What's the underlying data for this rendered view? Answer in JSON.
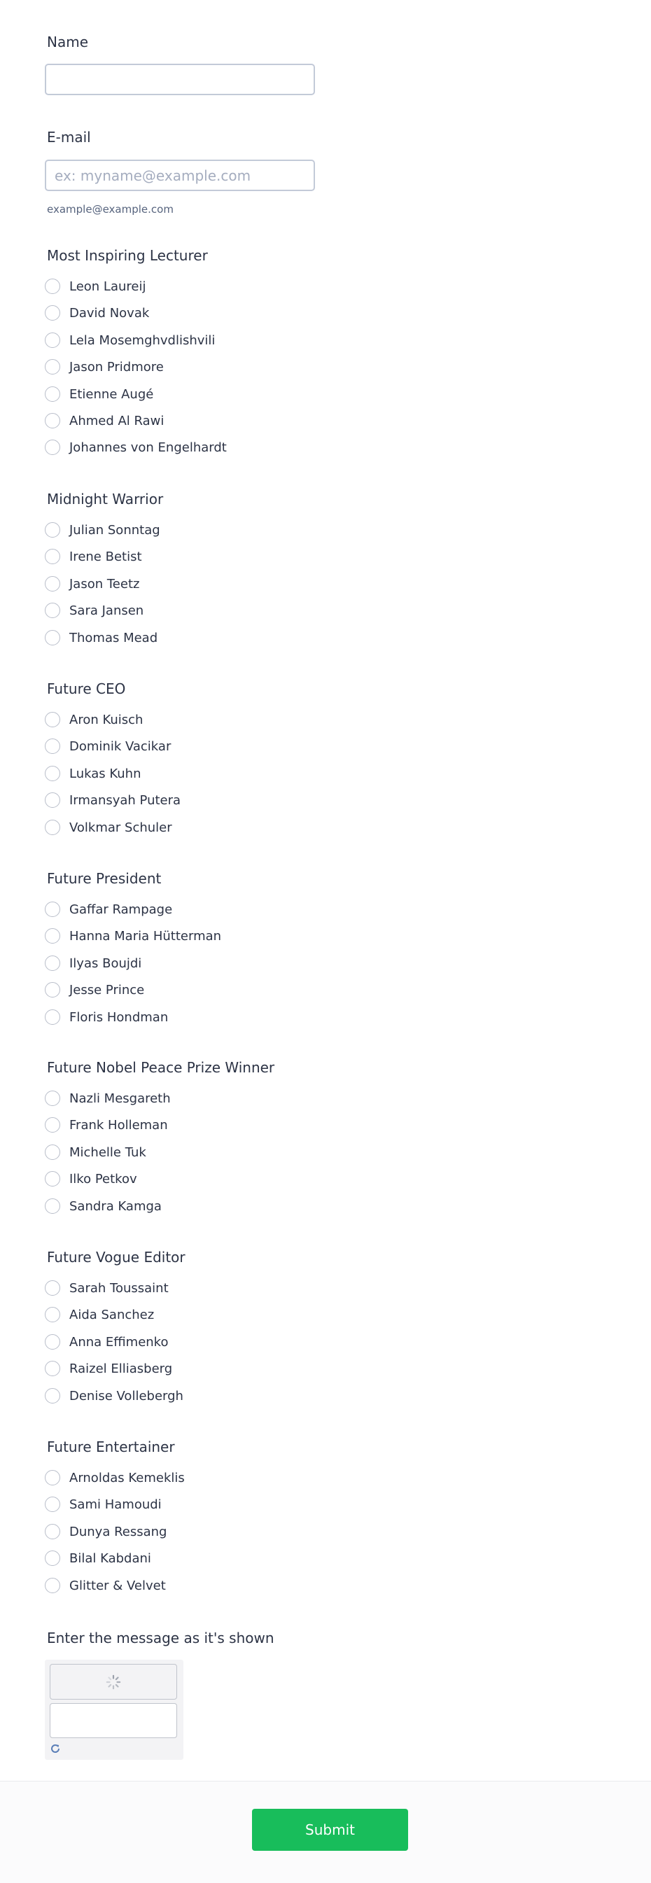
{
  "name_field": {
    "label": "Name",
    "value": ""
  },
  "email_field": {
    "label": "E-mail",
    "placeholder": "ex: myname@example.com",
    "sublabel": "example@example.com"
  },
  "categories": [
    {
      "title": "Most Inspiring Lecturer",
      "options": [
        "Leon Laureij",
        "David Novak",
        "Lela Mosemghvdlishvili",
        "Jason Pridmore",
        "Etienne Augé",
        "Ahmed Al Rawi",
        "Johannes von Engelhardt"
      ]
    },
    {
      "title": "Midnight Warrior",
      "options": [
        "Julian Sonntag",
        "Irene Betist",
        "Jason Teetz",
        "Sara Jansen",
        "Thomas Mead"
      ]
    },
    {
      "title": "Future CEO",
      "options": [
        "Aron Kuisch",
        "Dominik Vacikar",
        "Lukas Kuhn",
        "Irmansyah Putera",
        "Volkmar Schuler"
      ]
    },
    {
      "title": "Future President",
      "options": [
        "Gaffar Rampage",
        "Hanna Maria Hütterman",
        "Ilyas Boujdi",
        "Jesse Prince",
        "Floris Hondman"
      ]
    },
    {
      "title": "Future Nobel Peace Prize Winner",
      "options": [
        "Nazli Mesgareth",
        "Frank Holleman",
        "Michelle Tuk",
        "Ilko Petkov",
        "Sandra Kamga"
      ]
    },
    {
      "title": "Future Vogue Editor",
      "options": [
        "Sarah Toussaint",
        "Aida Sanchez",
        "Anna Effimenko",
        "Raizel Elliasberg",
        "Denise Vollebergh"
      ]
    },
    {
      "title": "Future Entertainer",
      "options": [
        "Arnoldas Kemeklis",
        "Sami Hamoudi",
        "Dunya Ressang",
        "Bilal Kabdani",
        "Glitter & Velvet"
      ]
    }
  ],
  "captcha": {
    "label": "Enter the message as it's shown",
    "icons": [
      "loading-spinner-icon",
      "refresh-icon"
    ]
  },
  "submit": {
    "label": "Submit"
  },
  "colors": {
    "accent": "#18bd5b",
    "text": "#2c3345",
    "border": "#c3cad8"
  }
}
